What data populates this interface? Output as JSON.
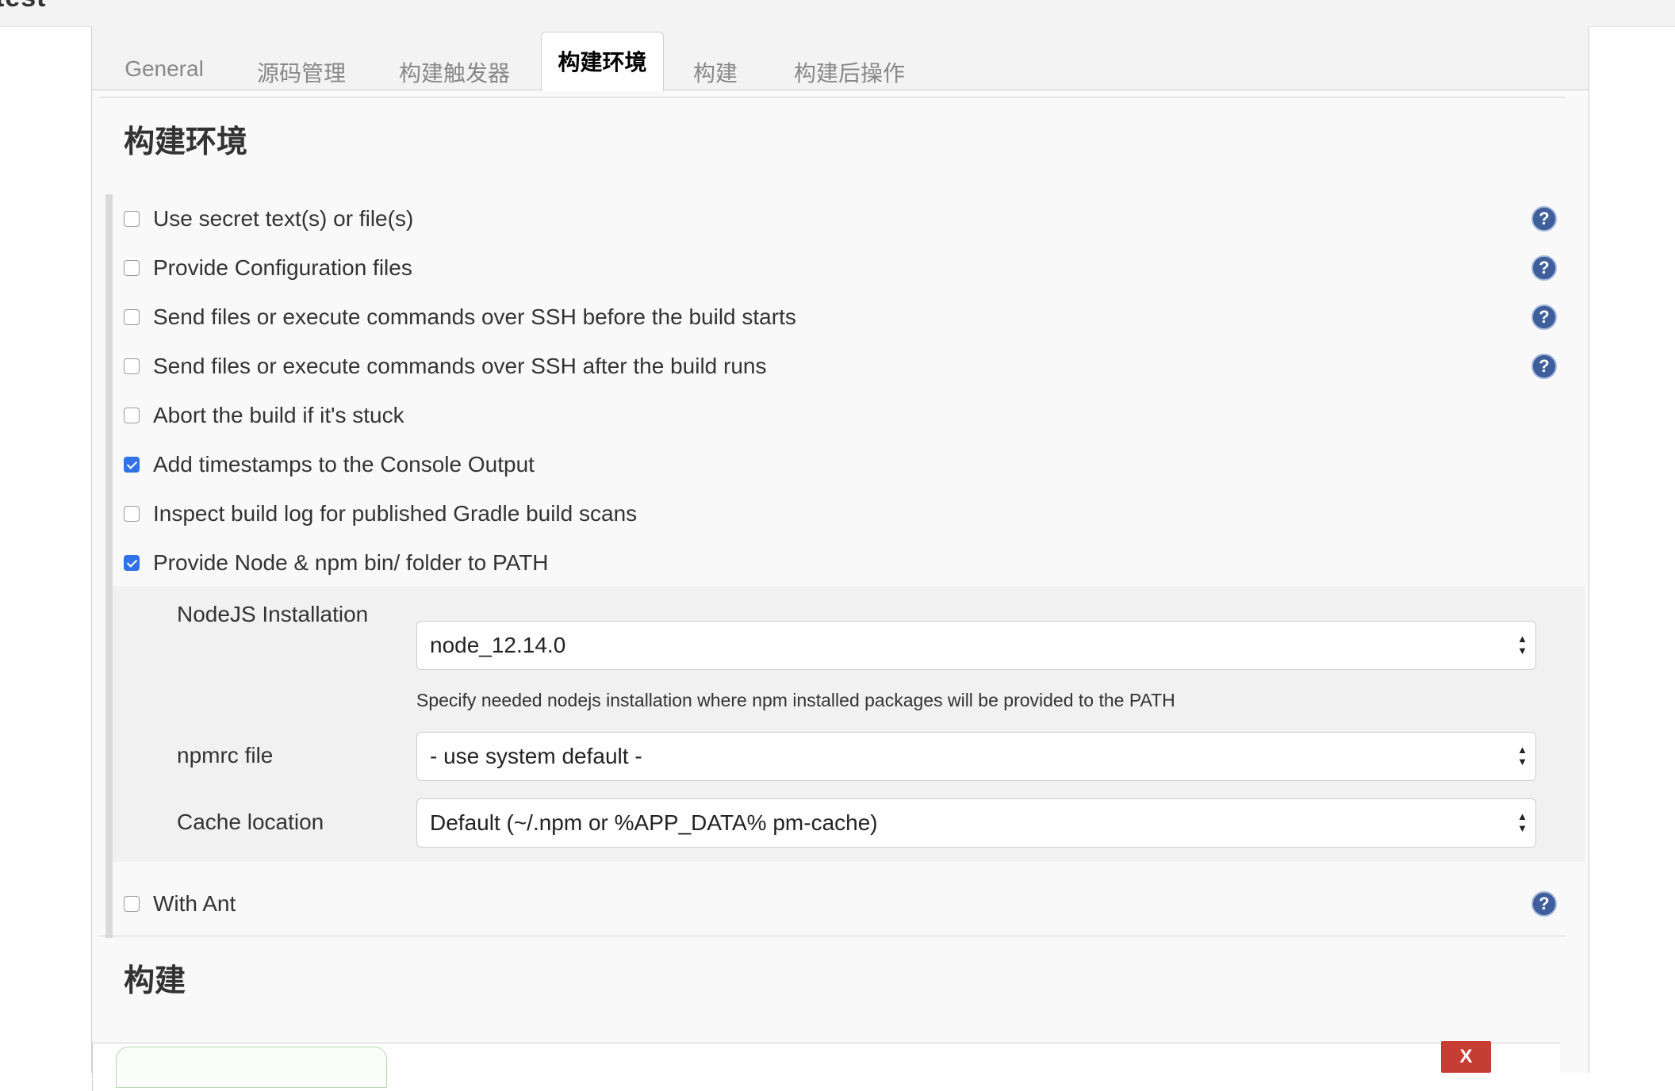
{
  "window": {
    "title": "test"
  },
  "tabs": [
    {
      "label": "General",
      "active": false
    },
    {
      "label": "源码管理",
      "active": false
    },
    {
      "label": "构建触发器",
      "active": false
    },
    {
      "label": "构建环境",
      "active": true
    },
    {
      "label": "构建",
      "active": false
    },
    {
      "label": "构建后操作",
      "active": false
    }
  ],
  "build_env": {
    "title": "构建环境",
    "options": [
      {
        "label": "Use secret text(s) or file(s)",
        "checked": false,
        "has_help": true
      },
      {
        "label": "Provide Configuration files",
        "checked": false,
        "has_help": true
      },
      {
        "label": "Send files or execute commands over SSH before the build starts",
        "checked": false,
        "has_help": true
      },
      {
        "label": "Send files or execute commands over SSH after the build runs",
        "checked": false,
        "has_help": true
      },
      {
        "label": "Abort the build if it's stuck",
        "checked": false,
        "has_help": false
      },
      {
        "label": "Add timestamps to the Console Output",
        "checked": true,
        "has_help": false
      },
      {
        "label": "Inspect build log for published Gradle build scans",
        "checked": false,
        "has_help": false
      },
      {
        "label": "Provide Node & npm bin/ folder to PATH",
        "checked": true,
        "has_help": false
      },
      {
        "label": "With Ant",
        "checked": false,
        "has_help": true
      }
    ],
    "node_settings": {
      "nodejs_installation": {
        "label": "NodeJS Installation",
        "value": "node_12.14.0",
        "description": "Specify needed nodejs installation where npm installed packages will be provided to the PATH"
      },
      "npmrc_file": {
        "label": "npmrc file",
        "value": "- use system default -"
      },
      "cache_location": {
        "label": "Cache location",
        "value": "Default (~/.npm or %APP_DATA% pm-cache)"
      }
    }
  },
  "build": {
    "title": "构建",
    "delete_label": "X"
  },
  "icons": {
    "help": "?"
  },
  "colors": {
    "checkbox_checked": "#2f72e8",
    "help_icon": "#3f5f9c",
    "delete_button": "#c53d33"
  }
}
